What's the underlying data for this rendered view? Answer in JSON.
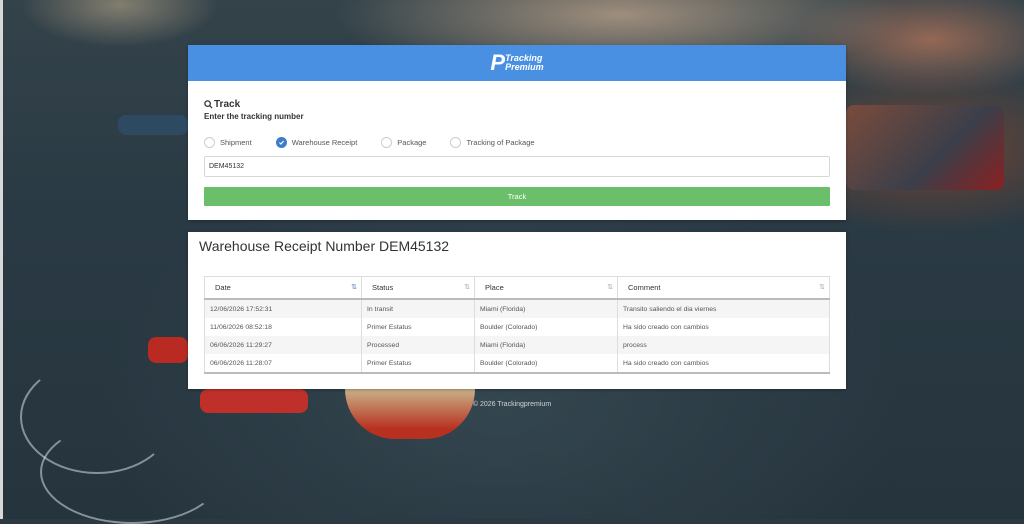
{
  "header": {
    "logo_mark": "P",
    "logo_line1": "Tracking",
    "logo_line2": "Premium"
  },
  "track": {
    "title": "Track",
    "subtitle": "Enter the tracking number",
    "options": [
      {
        "label": "Shipment",
        "checked": false
      },
      {
        "label": "Warehouse Receipt",
        "checked": true
      },
      {
        "label": "Package",
        "checked": false
      },
      {
        "label": "Tracking of Package",
        "checked": false
      }
    ],
    "input_value": "DEM45132",
    "button_label": "Track"
  },
  "result": {
    "title": "Warehouse Receipt Number DEM45132",
    "columns": [
      "Date",
      "Status",
      "Place",
      "Comment"
    ],
    "rows": [
      [
        "12/06/2026 17:52:31",
        "In transit",
        "Miami (Florida)",
        "Transito saliendo el dia viernes"
      ],
      [
        "11/06/2026 08:52:18",
        "Primer Estatus",
        "Boulder (Colorado)",
        "Ha sido creado con cambios"
      ],
      [
        "06/06/2026 11:29:27",
        "Processed",
        "Miami (Florida)",
        "process"
      ],
      [
        "06/06/2026 11:28:07",
        "Primer Estatus",
        "Boulder (Colorado)",
        "Ha sido creado con cambios"
      ]
    ]
  },
  "footer": {
    "text": "© 2026 Trackingpremium"
  },
  "colors": {
    "header_blue": "#4a90e2",
    "button_green": "#6bbf6b",
    "radio_checked": "#3c7cc8"
  }
}
